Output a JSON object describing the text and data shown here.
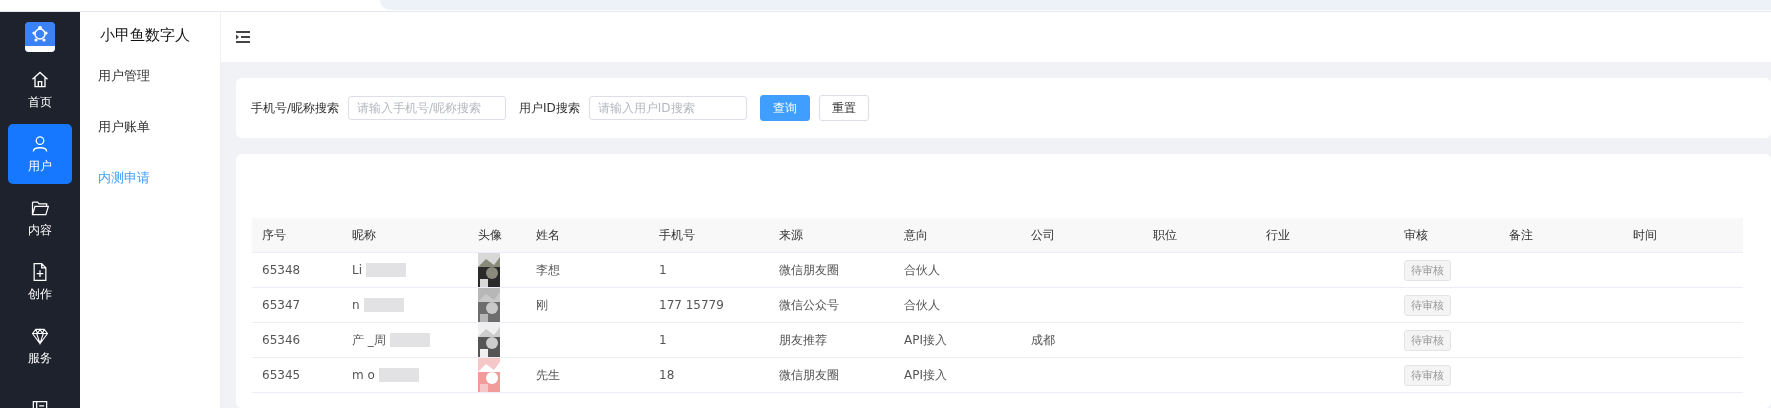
{
  "rail": {
    "items": [
      {
        "kind": "home",
        "label": "首页",
        "selected": false
      },
      {
        "kind": "user",
        "label": "用户",
        "selected": true
      },
      {
        "kind": "folder",
        "label": "内容",
        "selected": false
      },
      {
        "kind": "create",
        "label": "创作",
        "selected": false
      },
      {
        "kind": "service",
        "label": "服务",
        "selected": false
      },
      {
        "kind": "notes",
        "selected": false
      }
    ]
  },
  "submenu": {
    "title": "小甲鱼数字人",
    "items": [
      {
        "label": "用户管理",
        "selected": false
      },
      {
        "label": "用户账单",
        "selected": false
      },
      {
        "label": "内测申请",
        "selected": true
      }
    ]
  },
  "search": {
    "fields": [
      {
        "label": "手机号/昵称搜索",
        "placeholder": "请输入手机号/昵称搜索"
      },
      {
        "label": "用户ID搜索",
        "placeholder": "请输入用户ID搜索"
      }
    ],
    "buttons": [
      {
        "label": "查询",
        "kind": "primary"
      },
      {
        "label": "重置",
        "kind": "default"
      }
    ]
  },
  "table": {
    "columns": [
      "序号",
      "昵称",
      "头像",
      "姓名",
      "手机号",
      "来源",
      "意向",
      "公司",
      "职位",
      "行业",
      "审核",
      "备注",
      "时间"
    ],
    "rows": [
      {
        "id": "65348",
        "nickname": "Li",
        "name": "李想",
        "phone": "1",
        "source": "微信朋友圈",
        "intent": "合伙人",
        "review": "待审核"
      },
      {
        "id": "65347",
        "nickname": "n",
        "name": "刚",
        "phone": "177 15779",
        "source": "微信公众号",
        "intent": "合伙人",
        "review": "待审核"
      },
      {
        "id": "65346",
        "nickname": "产 _周",
        "phone": "1",
        "source": "朋友推荐",
        "intent": "API接入",
        "company": "成都",
        "review": "待审核"
      },
      {
        "id": "65345",
        "nickname": "m o",
        "name": "先生",
        "phone": "18",
        "source": "微信朋友圈",
        "intent": "API接入",
        "review": "待审核"
      }
    ]
  }
}
